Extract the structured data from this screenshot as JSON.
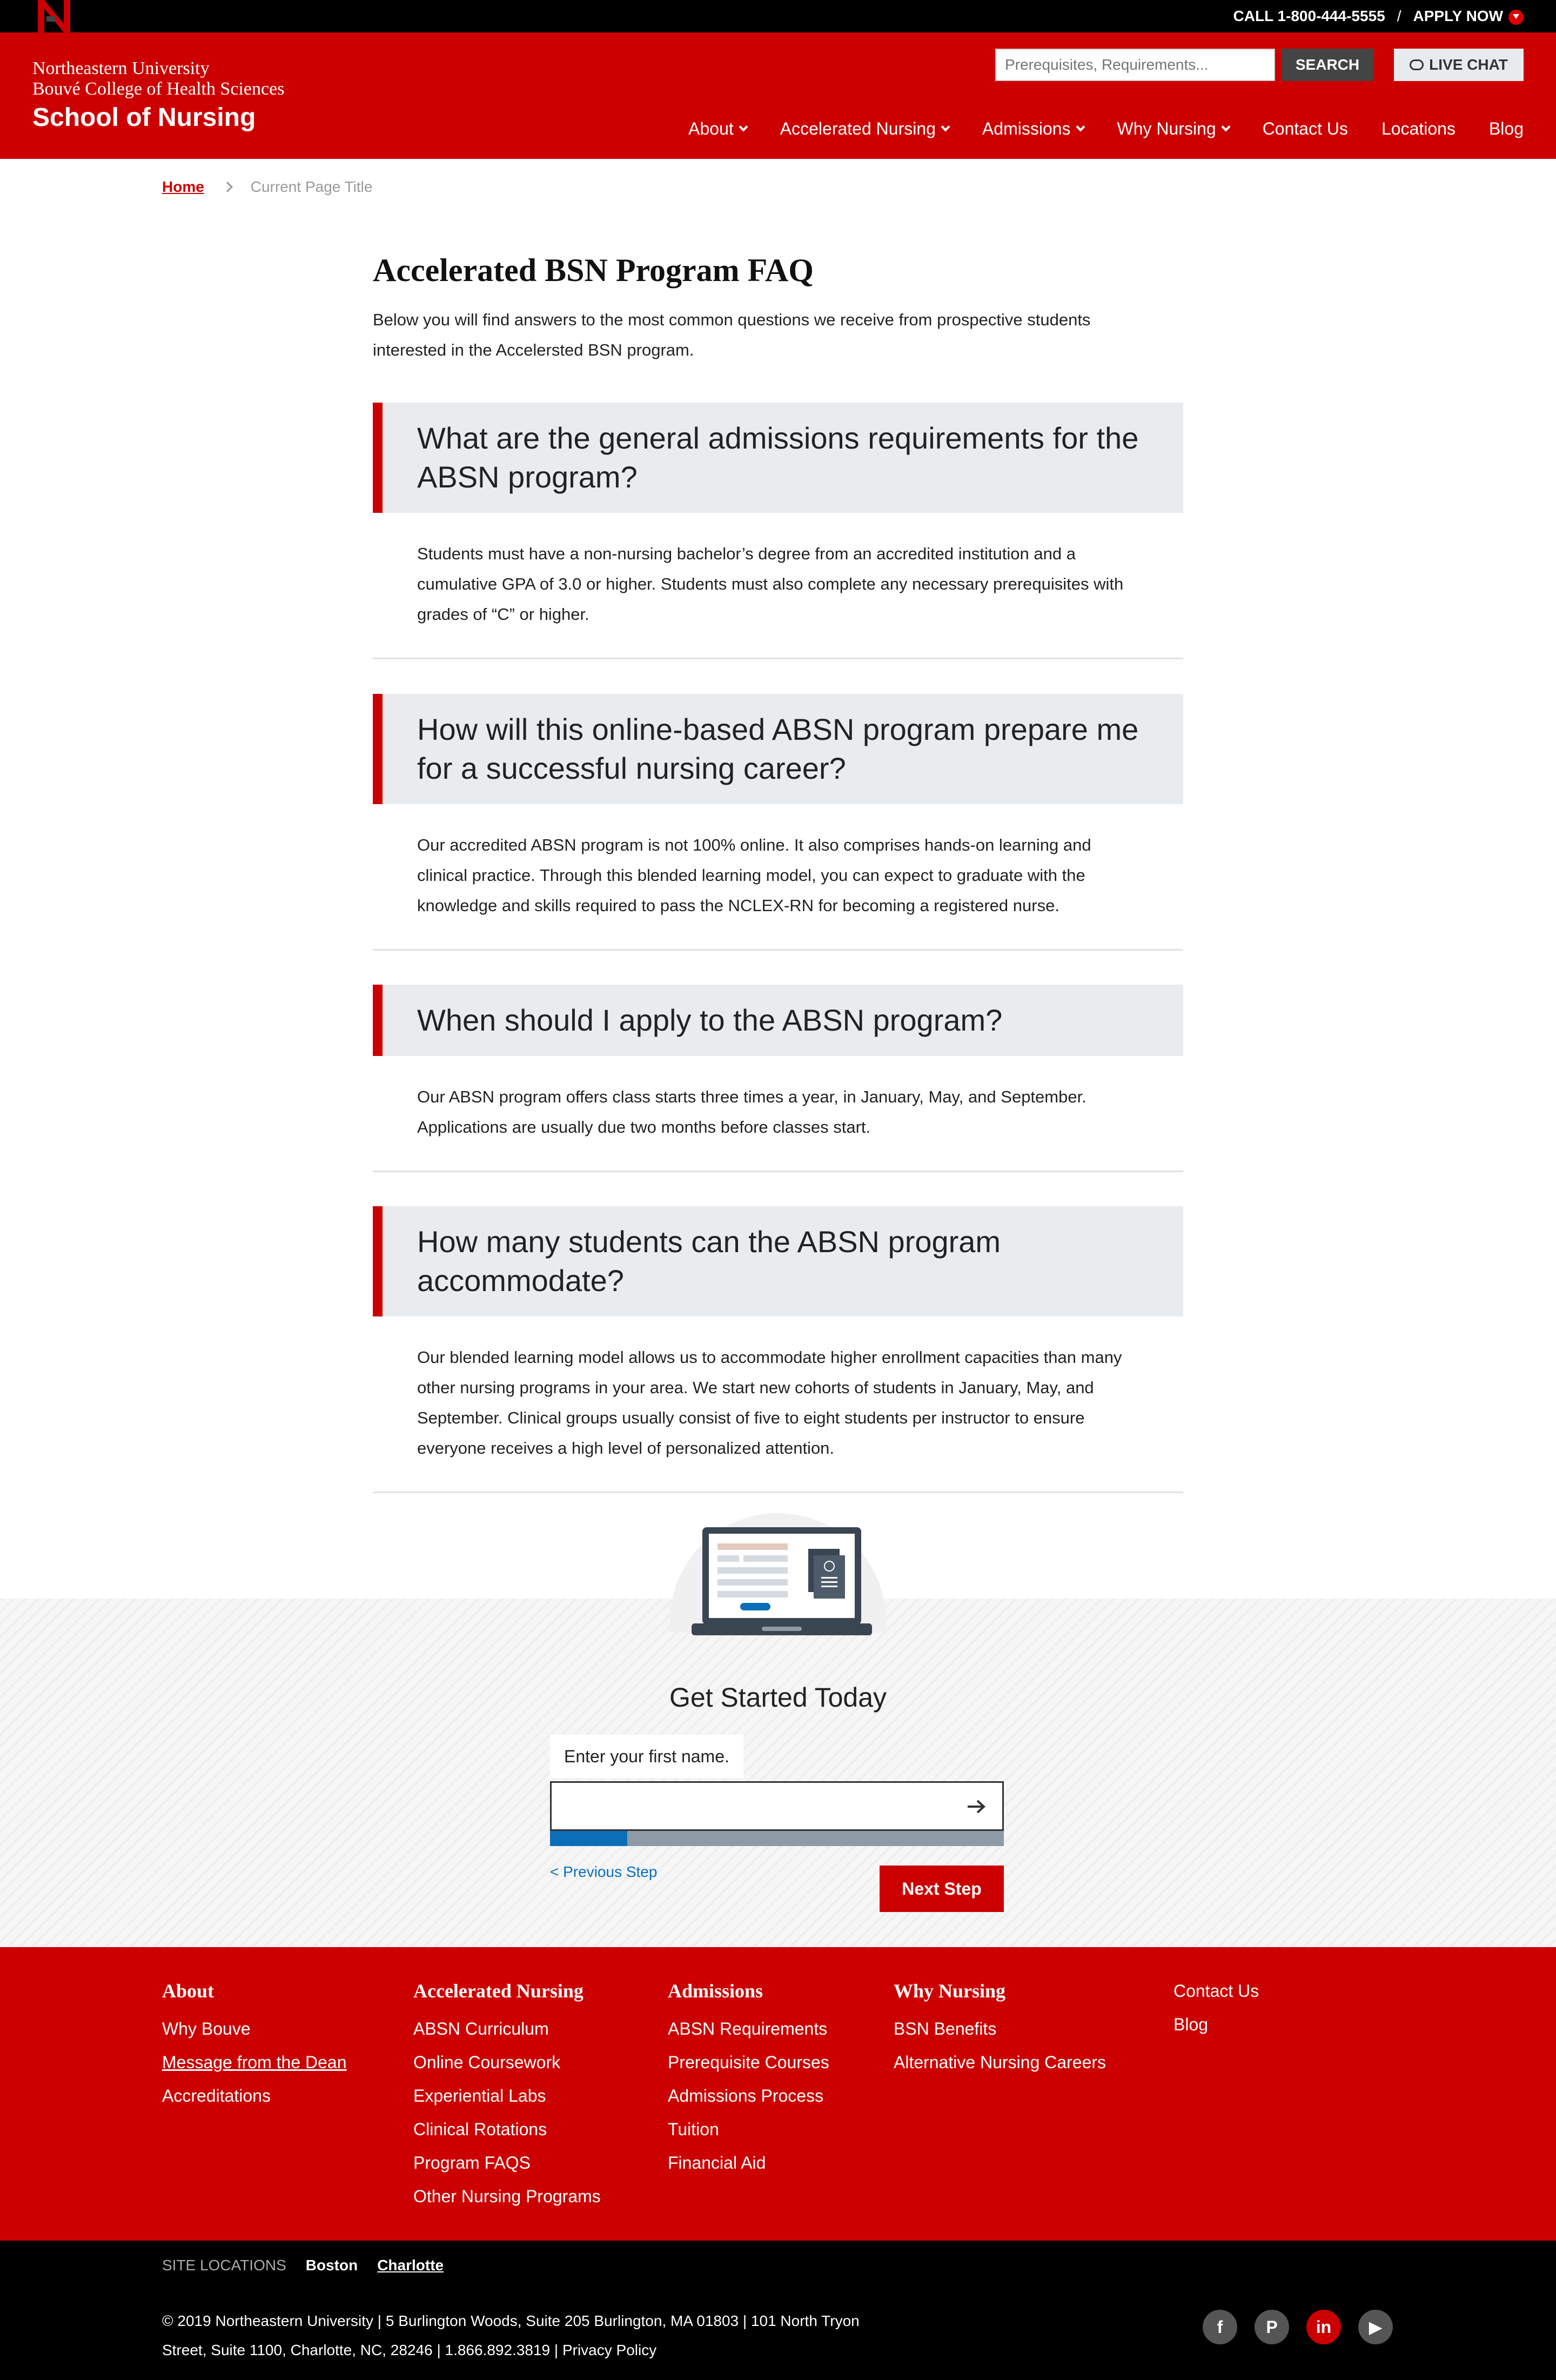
{
  "topbar": {
    "phone": "CALL 1-800-444-5555",
    "separator": "/",
    "apply": "APPLY NOW"
  },
  "header": {
    "brand_line1": "Northeastern University",
    "brand_line2": "Bouvé College of Health Sciences",
    "brand_line3": "School of Nursing",
    "search_placeholder": "Prerequisites, Requirements...",
    "search_button": "SEARCH",
    "chat_button": "LIVE CHAT",
    "nav": [
      {
        "label": "About"
      },
      {
        "label": "Accelerated Nursing"
      },
      {
        "label": "Admissions"
      },
      {
        "label": "Why Nursing"
      },
      {
        "label": "Contact Us"
      },
      {
        "label": "Locations"
      },
      {
        "label": "Blog"
      }
    ]
  },
  "breadcrumb": {
    "home": "Home",
    "current": "Current Page Title"
  },
  "main": {
    "title": "Accelerated BSN Program FAQ",
    "intro": "Below you will find answers to the most common questions we receive from prospective students interested in the Accelersted BSN program."
  },
  "faqs": [
    {
      "question": "What are the general admissions requirements for the ABSN program?",
      "answer": "Students must have a non-nursing bachelor’s degree from an accredited institution and a cumulative GPA of 3.0 or higher. Students must also complete any necessary prerequisites with grades of “C” or higher."
    },
    {
      "question": "How will this online-based ABSN program prepare me for a successful nursing career?",
      "answer": "Our accredited ABSN program is not 100% online. It also comprises hands-on learning and clinical practice. Through this blended learning model, you can expect to graduate with the knowledge and skills required to pass the NCLEX-RN for becoming a registered nurse."
    },
    {
      "question": "When should I apply to the ABSN program?",
      "answer": "Our ABSN program offers class starts three times a year, in January, May, and September. Applications are usually due two months before classes start."
    },
    {
      "question": "How many students can the ABSN program accommodate?",
      "answer": "Our blended learning model allows us to accommodate higher enrollment capacities than many other nursing programs in your area. We start new cohorts of students in January, May, and September. Clinical groups usually consist of five to eight students per instructor to ensure everyone receives a high level of personalized attention."
    }
  ],
  "get_started": {
    "title": "Get Started Today",
    "field_label": "Enter your first name.",
    "field_value": "",
    "progress": 0.17,
    "prev_step": "< Previous Step",
    "next_step": "Next Step"
  },
  "footer": {
    "columns": [
      {
        "heading": "About",
        "links": [
          "Why Bouve",
          "Message from the Dean",
          "Accreditations"
        ]
      },
      {
        "heading": "Accelerated Nursing",
        "links": [
          "ABSN Curriculum",
          "Online Coursework",
          "Experiential Labs",
          "Clinical Rotations",
          "Program FAQS",
          "Other Nursing Programs"
        ]
      },
      {
        "heading": "Admissions",
        "links": [
          "ABSN Requirements",
          "Prerequisite Courses",
          "Admissions Process",
          "Tuition",
          "Financial Aid"
        ]
      },
      {
        "heading": "Why Nursing",
        "links": [
          "BSN Benefits",
          "Alternative Nursing Careers"
        ]
      },
      {
        "heading": "",
        "links": [
          "Contact Us",
          "Blog"
        ]
      }
    ]
  },
  "bottom": {
    "site_locations_label": "SITE LOCATIONS",
    "boston": "Boston",
    "charlotte": "Charlotte",
    "copyright_line1": "© 2019 Northeastern University | 5 Burlington Woods, Suite 205 Burlington, MA 01803 | 101 North Tryon",
    "copyright_line2": "Street, Suite 1100, Charlotte, NC, 28246 | 1.866.892.3819 | Privacy Policy",
    "socials": [
      {
        "icon": "facebook-icon",
        "glyph": "f"
      },
      {
        "icon": "pinterest-icon",
        "glyph": "P"
      },
      {
        "icon": "linkedin-icon",
        "glyph": "in"
      },
      {
        "icon": "youtube-icon",
        "glyph": "▶"
      }
    ]
  },
  "colors": {
    "brand_red": "#cc0000",
    "faq_bg": "#e9ecef",
    "progress_blue": "#0a6fb8",
    "progress_track": "#8e9aa6",
    "topbar_black": "#000000"
  }
}
